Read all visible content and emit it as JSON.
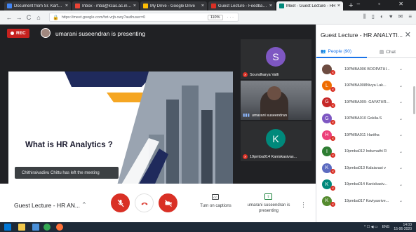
{
  "browser": {
    "tabs": [
      {
        "title": "Document from Sr. Karthi G",
        "fav_color": "#4285f4",
        "active": false
      },
      {
        "title": "Inbox - mba@kcas.ac.in - Kon",
        "fav_color": "#ea4335",
        "active": false
      },
      {
        "title": "My Drive - Google Drive",
        "fav_color": "#fbbc04",
        "active": false
      },
      {
        "title": "Guest Lecture - Feedback - HR",
        "fav_color": "#d93025",
        "active": false
      },
      {
        "title": "Meet - Guest Lecture - HR",
        "fav_color": "#00897b",
        "active": true
      }
    ],
    "tab_close": "×",
    "new_tab": "+",
    "window_controls": "–  ▫  ✕",
    "back": "←",
    "forward": "→",
    "reload": "C",
    "home": "⌂",
    "url": "https://meet.google.com/hrt-vrjb-xwy?authuser=0",
    "zoom": "110%",
    "more": "···",
    "toolbar_icons": [
      "⫼",
      "▯",
      "◐",
      "♥",
      "✉",
      "≡"
    ]
  },
  "meet": {
    "rec_label": "REC",
    "presenting_text": "umarani suseendran is presenting",
    "slide_title": "What is HR Analytics ?",
    "toast": "Chithiraivadivu Chittu has left the meeting",
    "tiles": [
      {
        "initial": "S",
        "name": "Soundharya Valli",
        "color": "#7e57c2"
      },
      {
        "name": "umarani suseendran"
      },
      {
        "initial": "K",
        "name": "19pmba014 Kaniskasivas...",
        "color": "#00897b"
      }
    ],
    "bottom": {
      "meeting_title": "Guest Lecture - HR AN...",
      "caret": "^",
      "captions_label": "Turn on captions",
      "captions_icon": "CC",
      "presenting_label": "umarani suseendran is presenting",
      "present_icon": "⇪",
      "more": "⋮"
    },
    "colors": {
      "danger": "#d93025",
      "accent": "#1a73e8"
    }
  },
  "panel": {
    "title": "Guest Lecture - HR ANALYTI...",
    "close": "✕",
    "people_tab": "People (90)",
    "chat_tab": "Chat",
    "people_icon": "👥",
    "chat_icon": "▤",
    "people": [
      {
        "initial": "",
        "name": "19PMBA006 BOOPATHI...",
        "color": "#6d4c41"
      },
      {
        "initial": "L",
        "name": "19PMBA008Nivya Lak...",
        "color": "#ef6c00"
      },
      {
        "initial": "G",
        "name": "19PMBA009- GAYATHR...",
        "color": "#c62828"
      },
      {
        "initial": "G",
        "name": "19PMBA010 Gokila.S",
        "color": "#7e57c2"
      },
      {
        "initial": "H",
        "name": "19PMBA011 Haritha",
        "color": "#ec407a"
      },
      {
        "initial": "I",
        "name": "19pmba012 Indumathi R",
        "color": "#2e7d32"
      },
      {
        "initial": "K",
        "name": "19pmba013 Kalaiarasi v",
        "color": "#5c6bc0"
      },
      {
        "initial": "K",
        "name": "19pmba014 Kaniskasiv...",
        "color": "#00897b"
      },
      {
        "initial": "K",
        "name": "19pmba017 Kaviyasrive...",
        "color": "#558b2f"
      }
    ],
    "chevron": "⌄"
  },
  "taskbar": {
    "time": "14:03",
    "date": "15-06-2020",
    "lang": "ENG",
    "tray_icons": "^ ☐ ◀ ▭"
  }
}
